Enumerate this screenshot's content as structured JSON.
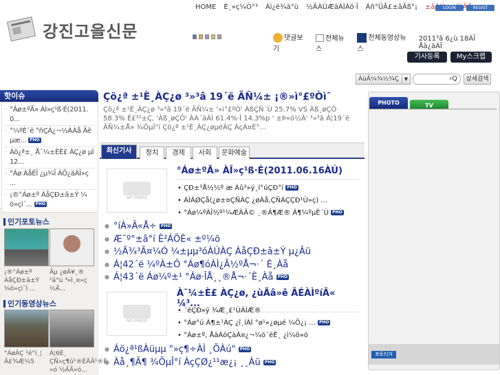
{
  "topnav": {
    "items": [
      "HOME",
      "È¸»ç¼Ò°³",
      "Àì¿ë¾à°ü",
      "½ÃÀÚÆäÀÌÁö·Î",
      "Áñ°ÜÃ£±âÃß°¡"
    ],
    "highlight": "±âÀÚ¸¿ø¾ÃÃ»",
    "login": "LOGIN",
    "regist": "REGIST"
  },
  "site": {
    "title": "강진고을신문"
  },
  "theme_colors": [
    "#5a7a9a",
    "#e0b040",
    "#a090c0",
    "#d8c070",
    "#a0a0a0"
  ],
  "links": {
    "comments": "댓글보기",
    "all_news": "전체뉴스",
    "all_video": "전체동영상뉴스",
    "date": "2011³â 6¿ù 18ÀÏ Åä¿äÀÏ"
  },
  "buttons": {
    "write": "기사등록",
    "scrap": "My스크랩"
  },
  "search": {
    "select": "ÀüÃ¼¾½¾Ç",
    "icon": "›Q",
    "advanced": "상세검색"
  },
  "hot": {
    "title": "핫이슈",
    "items": [
      "°Áø±ºÃ» ÀÌ»ç¹ß·É(2011.0...",
      "°¼ºÈ´ë °ñÇÁ¿¬½ÀÀå Ãëµæ...",
      "Áö¿ª±¸ Å¨¼±ÈÈ£ ÀÇ¿ø µî 12...",
      "°Áø ÀåÈÏ ¿µ¾Ï ÁÖ¿äÀÎ»ç ...",
      "¡®°Áø±º ÀåÇÐ±â±Ý ¼ö»çì¯..."
    ],
    "pho": [
      false,
      true,
      false,
      false,
      true
    ],
    "pho_label": "PHO"
  },
  "photo_news": {
    "title": "인기포토뉴스",
    "captions": [
      "¡®°Áø±º ÀåÇÐ±â±Ý ¼ö»çì¯Ì ...",
      "Ãµ ¿øÂ¥¸® ¹ä°ú ³»Ì¸¤»ç ½Ä..."
    ]
  },
  "video_news": {
    "title": "인기동영상뉴스",
    "captions": [
      "°ÁøÀÇ ¹é°í¸¦ Ã£¾Æ¼5",
      "Á¦6È¸ ÇÑ»ç¶û¹®ÈÄÃ¹®È »ó ½ÃÃ»ó..."
    ]
  },
  "top_story": {
    "title": "Çö¿ª ±¹È¸ÀÇ¿ø ³»³â 19´ë ÃÑ¼± ¡®»ì°£ºÒì¯",
    "summary": "Çö¿ª ±¹È¸ÀÇ¿ø ³»³â 19´ë ÃÑ¼± '»ì°£ºÒ' ÀßÇÑ´Ù 25.7% VS Àß¸øÇÔ 58.3% È£³²±Ç, 'Àß¸øÇÔ' ÀÀ´äÀÌ 61.4%·Î 14.3%p ' ±Þ»ó½Â' ³»³â Á¦19´ë ÃÑ¼±Å» ¾ÕµÎ°í Çö¿ª ±¹È¸ÀÇ¿øµéÀÇ ÀçÁ¤È°..."
  },
  "tabs": [
    "최신기사",
    "정치",
    "경제",
    "사회",
    "문화예술"
  ],
  "articles": [
    {
      "title": "°Áø±ºÃ» ÀÎ»ç¹ß·É(2011.06.16ÀÚ)",
      "subs": [
        "ÇÐ±³Å½½º æ Àû³»ý¸í°úÇÐ°í",
        "ÀÌÁØÇå(¿ø±¤ÇÑÀÇ ¿øÀå,ÇÑÀÇÇÐ¹Ú»ç) ...",
        "°Áø¼ºÀÌ½º¹¼ÆÀÂ© ¸®Á¶Æ® Á¶¼ºµÈ´Ù"
      ],
      "sub_pho": [
        true,
        false,
        true
      ],
      "no_image": "NO IMAGE"
    },
    {
      "title": "À¯¼±È£ ÀÇ¿ø, ¿ùÃâ»ê ÄÉÀÌºíÄ« ¼³...",
      "subs": [
        "´ëÇÐ»ý ¾Æ¸£¹ÙÀÌÆ®",
        "°Áø°ú Á¶±¹ÀÇ ¿î¸íÀÌ °ø¹«¿øµé ¼Õ¿¡ ...",
        "°Áø±º, ÅäÁöÇàÁ¤¿¬¼ö´ëÈ¸ ¿ì¼ö»ó"
      ],
      "sub_pho": [
        false,
        true,
        false
      ],
      "no_image": "NO IMAGE"
    }
  ],
  "list1": [
    {
      "t": "°íÀ»Ã«Å÷",
      "p": true
    },
    {
      "t": "Æ¯º°±â°í È²ÁÖÈ« ±º¼ö",
      "p": false
    },
    {
      "t": "½Ã¾³Ã¤¼Ò ¼±µµ³óÀÚÀÇ ÀåÇÐ±â±Ý µ¿Âü",
      "p": false
    },
    {
      "t": "Á¦42´ë ¼ºÀ±Ô °Áø¶óÀÌ¿Â½ºÅ¬·´ È¸Àå",
      "p": false
    },
    {
      "t": "Á¦43´ë Áø¼º±¹ °Áø·ÎÅ¸¸®Å¬·´È¸Àå",
      "p": true
    }
  ],
  "list2": [
    {
      "t": "Áö¿ª¹ßÀüµµ \"»ç¶÷ÀÌ ¸ÕÀú\"",
      "p": true
    },
    {
      "t": "Àå¸¶Ã¶ ¾ÕµÎ°í ÀçÇØ¿¹¹æ¿¡ ¸¸Àü",
      "p": true
    }
  ],
  "right": {
    "tab_photo": "PHOTO",
    "tab_tv": "TV",
    "ticker": "포토티거"
  }
}
